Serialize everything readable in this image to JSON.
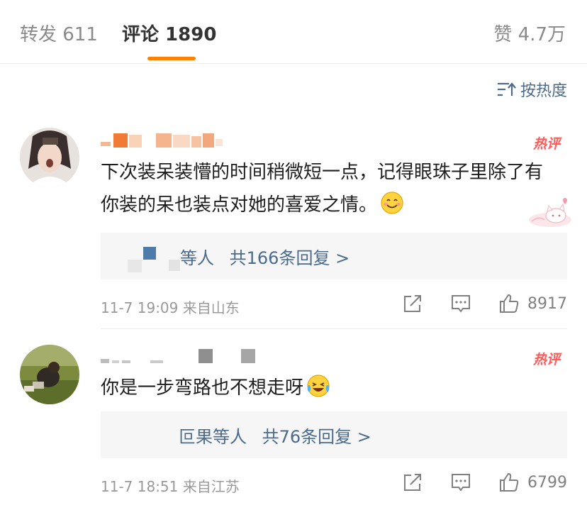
{
  "tabs": {
    "repost": "转发 611",
    "comments": "评论 1890",
    "likes": "赞 4.7万"
  },
  "sort": {
    "label": "按热度"
  },
  "comments": [
    {
      "badge": "热评",
      "text": "下次装呆装懵的时间稍微短一点，记得眼珠子里除了有你装的呆也装点对她的喜爱之情。",
      "emoji": "smile-emoji",
      "reply_names": "等人",
      "reply_count": "共166条回复 >",
      "time": "11-7 19:09",
      "source": "来自山东",
      "likes": "8917"
    },
    {
      "badge": "热评",
      "text": "你是一步弯路也不想走呀",
      "emoji": "laugh-cry-emoji",
      "reply_names": "叵果等人",
      "reply_count": "共76条回复 >",
      "time": "11-7 18:51",
      "source": "来自江苏",
      "likes": "6799"
    }
  ],
  "colors": {
    "accent": "#ff8200",
    "link": "#4a6b8c",
    "hot": "#ff5b5b"
  }
}
